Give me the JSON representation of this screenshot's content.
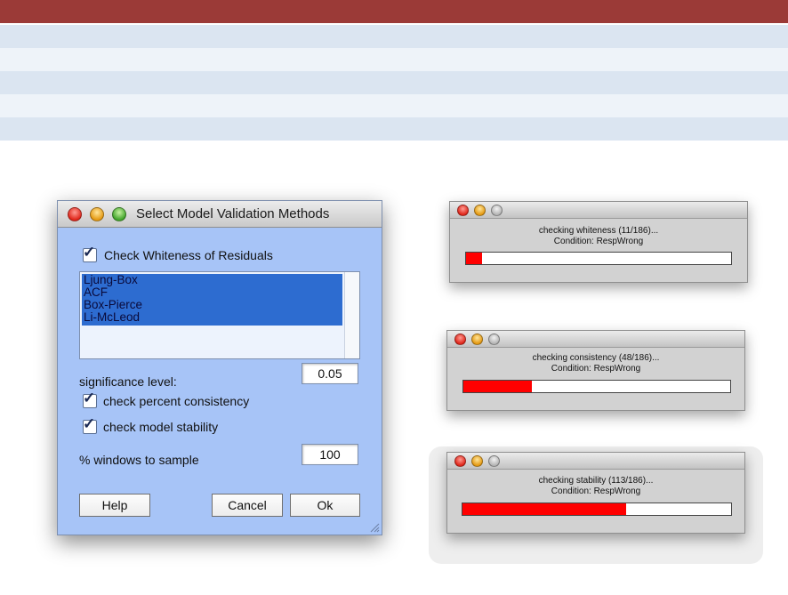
{
  "dialog": {
    "title": "Select Model Validation Methods",
    "whiteness_label": "Check Whiteness of Residuals",
    "whiteness_checked": true,
    "methods": [
      "Ljung-Box",
      "ACF",
      "Box-Pierce",
      "Li-McLeod"
    ],
    "significance_label": "significance level:",
    "significance_value": "0.05",
    "consistency_label": "check percent consistency",
    "consistency_checked": true,
    "stability_label": "check model stability",
    "stability_checked": true,
    "windows_label": "% windows to sample",
    "windows_value": "100",
    "help_label": "Help",
    "cancel_label": "Cancel",
    "ok_label": "Ok"
  },
  "progress": [
    {
      "line1": "checking whiteness (11/186)...",
      "line2": "Condition: RespWrong",
      "fraction": 0.059
    },
    {
      "line1": "checking consistency (48/186)...",
      "line2": "Condition: RespWrong",
      "fraction": 0.258
    },
    {
      "line1": "checking stability (113/186)...",
      "line2": "Condition: RespWrong",
      "fraction": 0.608
    }
  ],
  "colors": {
    "banner": "#9b3a37",
    "dialog_bg": "#a7c4f7",
    "selection": "#2d6cd0",
    "progress_fill": "#ff0000"
  }
}
